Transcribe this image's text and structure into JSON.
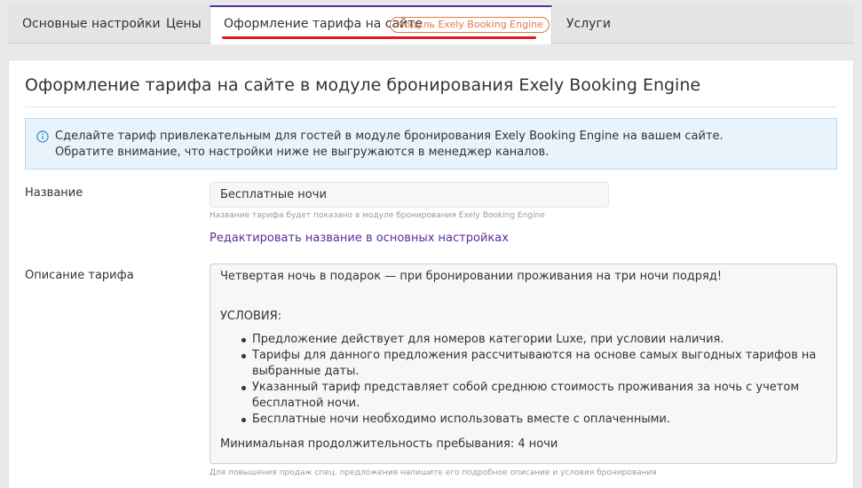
{
  "tabs": {
    "main": "Основные настройки",
    "prices": "Цены",
    "site_design": "Оформление тарифа на сайте",
    "site_design_badge": "Модуль Exely Booking Engine",
    "services": "Услуги"
  },
  "page": {
    "title": "Оформление тарифа на сайте в модуле бронирования Exely Booking Engine"
  },
  "info": {
    "line1": "Сделайте тариф привлекательным для гостей в модуле бронирования Exely Booking Engine на вашем сайте.",
    "line2": "Обратите внимание, что настройки ниже не выгружаются в менеджер каналов."
  },
  "name_field": {
    "label": "Название",
    "value": "Бесплатные ночи",
    "hint": "Название тарифа будет показано в модуле бронирования Exely Booking Engine",
    "edit_link": "Редактировать название в основных настройках"
  },
  "description_field": {
    "label": "Описание тарифа",
    "intro": "Четвертая ночь в подарок — при бронировании проживания на три ночи подряд!",
    "conditions_heading": "УСЛОВИЯ:",
    "items": [
      "Предложение действует для номеров категории Luxe, при условии наличия.",
      "Тарифы для данного предложения рассчитываются на основе самых выгодных тарифов на выбранные даты.",
      "Указанный тариф представляет собой среднюю стоимость проживания за ночь с учетом бесплатной ночи.",
      "Бесплатные ночи необходимо использовать вместе с оплаченными."
    ],
    "min_stay": "Минимальная продолжительность пребывания: 4 ночи",
    "hint": "Для повышения продаж спец. предложения напишите его подробное описание и условия бронирования"
  },
  "colors": {
    "accent": "#5a2d9c",
    "badge": "#e07a46",
    "underline": "#e2191f",
    "info_bg": "#e8f3fb",
    "info_icon": "#2e86c9"
  }
}
